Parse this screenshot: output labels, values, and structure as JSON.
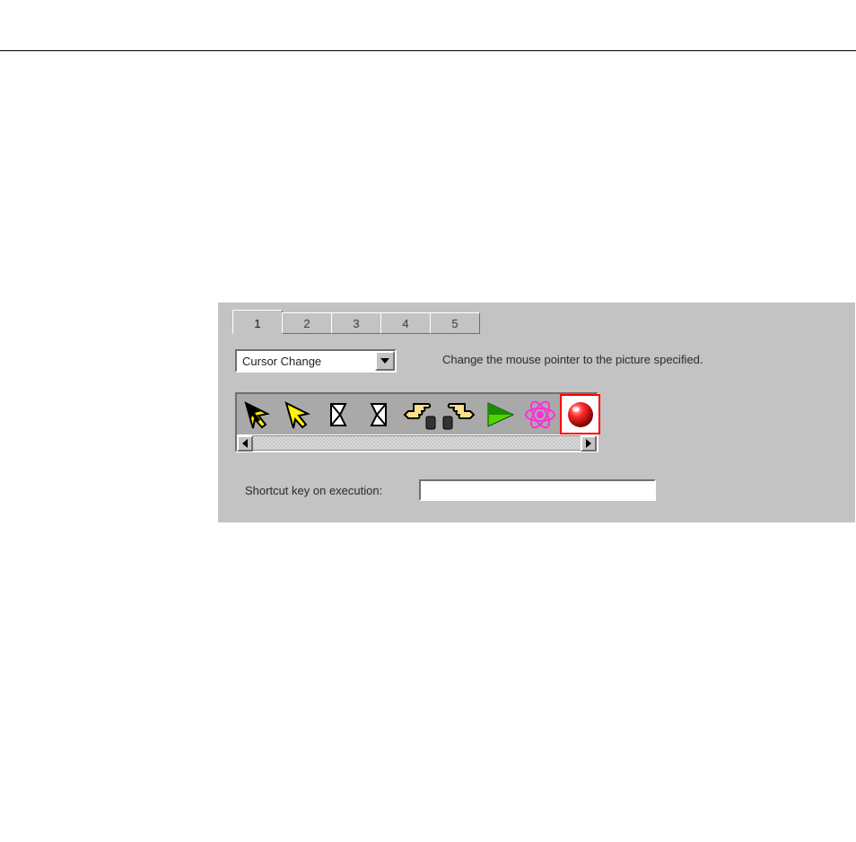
{
  "tabs": [
    "1",
    "2",
    "3",
    "4",
    "5"
  ],
  "active_tab_index": 0,
  "select": {
    "selected": "Cursor Change"
  },
  "description": "Change the mouse pointer to the picture specified.",
  "cursor_items": [
    "arrow-nw-black",
    "arrow-nw-yellow",
    "page-curl-left",
    "page-curl-right",
    "hand-point-left",
    "hand-point-right",
    "play-green",
    "atom-pink",
    "ball-red"
  ],
  "selected_cursor_index": 8,
  "shortcut": {
    "label": "Shortcut key on execution:",
    "value": ""
  }
}
